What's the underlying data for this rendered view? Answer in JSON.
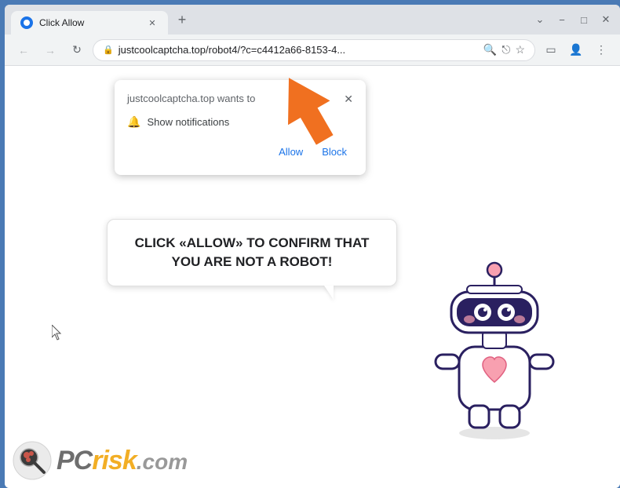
{
  "browser": {
    "tab": {
      "title": "Click Allow",
      "favicon_label": "browser-favicon"
    },
    "new_tab_label": "+",
    "window_controls": {
      "minimize": "−",
      "maximize": "□",
      "close": "✕"
    },
    "address_bar": {
      "url": "justcoolcaptcha.top/robot4/?c=c4412a66-8153-4...",
      "lock_icon": "🔒"
    },
    "nav": {
      "back": "←",
      "forward": "→",
      "refresh": "↻"
    }
  },
  "notification_popup": {
    "domain_text": "justcoolcaptcha.top wants to",
    "show_notifications_label": "Show notifications",
    "allow_label": "Allow",
    "block_label": "Block"
  },
  "speech_bubble": {
    "text": "CLICK «ALLOW» TO CONFIRM THAT YOU ARE NOT A ROBOT!"
  },
  "watermark": {
    "brand_pc": "PC",
    "brand_risk": "risk",
    "brand_dotcom": ".com"
  },
  "colors": {
    "accent_blue": "#4a7ab5",
    "orange_arrow": "#f07020",
    "tab_bg": "#f1f3f4",
    "url_bar_bg": "#dee1e6"
  }
}
